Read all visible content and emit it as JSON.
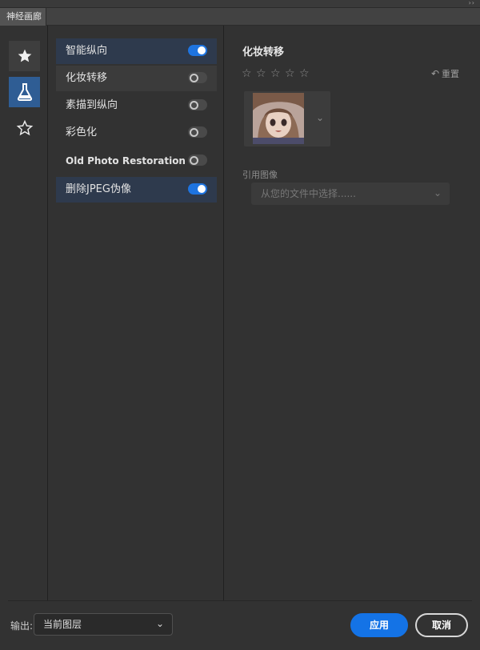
{
  "window": {
    "tab_title": "神经画廊",
    "titlebar_dots": "››"
  },
  "rail": [
    {
      "icon": "filled-star-icon",
      "state": "normal"
    },
    {
      "icon": "flask-icon",
      "state": "selected"
    },
    {
      "icon": "outline-star-icon",
      "state": "normal"
    }
  ],
  "filters": [
    {
      "label": "智能纵向",
      "enabled": true
    },
    {
      "label": "化妆转移",
      "enabled": false
    },
    {
      "label": "素描到纵向",
      "enabled": false
    },
    {
      "label": "彩色化",
      "enabled": false
    },
    {
      "label": "Old Photo Restoration",
      "enabled": false
    },
    {
      "label": "删除JPEG伪像",
      "enabled": true
    }
  ],
  "details": {
    "title": "化妆转移",
    "rating_stars": [
      "☆",
      "☆",
      "☆",
      "☆",
      "☆"
    ],
    "reset_icon": "↶",
    "reset_label": "重置",
    "preset_chevron": "⌄",
    "reference_label": "引用图像",
    "reference_placeholder": "从您的文件中选择......",
    "reference_chevron": "⌄"
  },
  "footer": {
    "output_label": "输出:",
    "output_value": "当前图层",
    "output_chevron": "⌄",
    "apply_label": "应用",
    "cancel_label": "取消"
  },
  "colors": {
    "accent": "#1473e6",
    "selected_rail": "#2f5d94",
    "enabled_row": "#2e3a4d",
    "panel_bg": "#323232"
  }
}
